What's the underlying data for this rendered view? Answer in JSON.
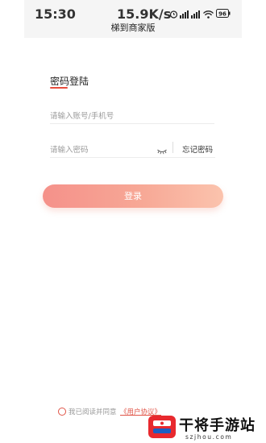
{
  "status_bar": {
    "time": "15:30",
    "speed": "15.9K/s",
    "battery": "96",
    "icons": [
      "alarm-icon",
      "signal-icon",
      "signal-icon",
      "wifi-icon",
      "battery-icon"
    ]
  },
  "app_bar": {
    "title": "梯到商家版"
  },
  "login": {
    "section_title": "密码登陆",
    "account_placeholder": "请输入账号/手机号",
    "password_placeholder": "请输入密码",
    "forgot_password": "忘记密码",
    "login_button": "登录"
  },
  "agreement": {
    "text": "我已阅读并同意",
    "link": "《用户协议》"
  },
  "watermark": {
    "name": "干将手游站",
    "url": "szjhou.com"
  },
  "colors": {
    "accent": "#e74c3c",
    "button_gradient_start": "#f5918a",
    "button_gradient_end": "#fbc3ad",
    "placeholder": "#9a9a9a"
  }
}
